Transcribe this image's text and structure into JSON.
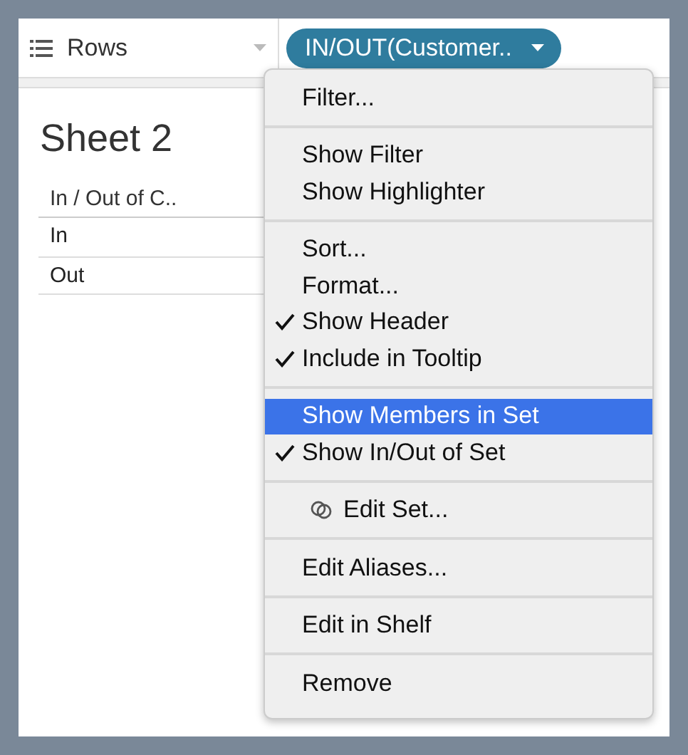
{
  "shelf": {
    "label": "Rows",
    "pill": "IN/OUT(Customer.."
  },
  "sheet": {
    "title": "Sheet 2",
    "column_header": "In / Out of C..",
    "rows": [
      "In",
      "Out"
    ]
  },
  "menu": {
    "groups": [
      [
        {
          "label": "Filter...",
          "kind": "plain",
          "checked": false,
          "selected": false
        }
      ],
      [
        {
          "label": "Show Filter",
          "kind": "plain",
          "checked": false,
          "selected": false
        },
        {
          "label": "Show Highlighter",
          "kind": "plain",
          "checked": false,
          "selected": false
        }
      ],
      [
        {
          "label": "Sort...",
          "kind": "plain",
          "checked": false,
          "selected": false
        },
        {
          "label": "Format...",
          "kind": "plain",
          "checked": false,
          "selected": false
        },
        {
          "label": "Show Header",
          "kind": "plain",
          "checked": true,
          "selected": false
        },
        {
          "label": "Include in Tooltip",
          "kind": "plain",
          "checked": true,
          "selected": false
        }
      ],
      [
        {
          "label": "Show Members in Set",
          "kind": "plain",
          "checked": false,
          "selected": true
        },
        {
          "label": "Show In/Out of Set",
          "kind": "plain",
          "checked": true,
          "selected": false
        }
      ],
      [
        {
          "label": "Edit Set...",
          "kind": "set",
          "checked": false,
          "selected": false
        }
      ],
      [
        {
          "label": "Edit Aliases...",
          "kind": "plain",
          "checked": false,
          "selected": false
        }
      ],
      [
        {
          "label": "Edit in Shelf",
          "kind": "plain",
          "checked": false,
          "selected": false
        }
      ],
      [
        {
          "label": "Remove",
          "kind": "plain",
          "checked": false,
          "selected": false
        }
      ]
    ]
  }
}
